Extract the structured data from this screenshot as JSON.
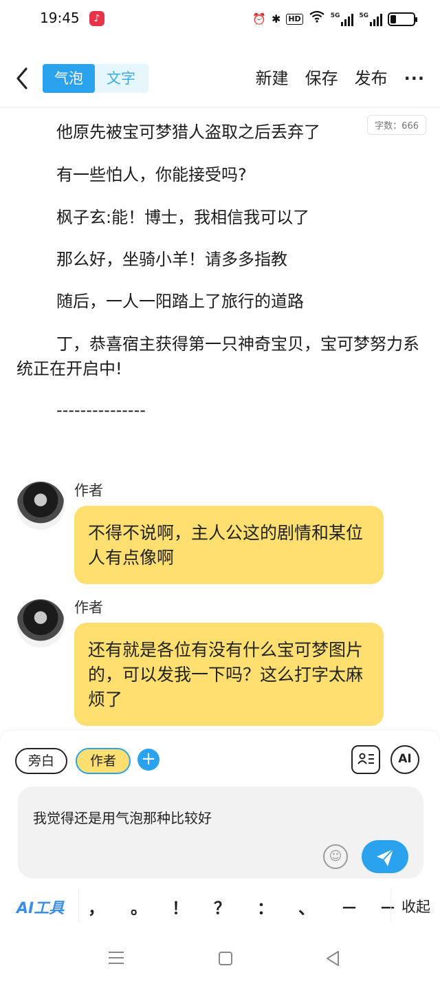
{
  "status_bar": {
    "time": "19:45",
    "battery_level": 0.25,
    "icons": [
      "alarm-icon",
      "bluetooth-icon",
      "hd-icon",
      "wifi-icon",
      "signal-5g-icon",
      "signal-5g-icon",
      "battery-icon"
    ],
    "hd_label": "HD",
    "net1_label": "5G",
    "net2_label": "5G"
  },
  "header": {
    "mode_tabs": [
      {
        "label": "气泡",
        "active": true
      },
      {
        "label": "文字",
        "active": false
      }
    ],
    "actions": {
      "new_label": "新建",
      "save_label": "保存",
      "publish_label": "发布",
      "more_label": "···"
    }
  },
  "word_count": "字数：666",
  "paragraphs": [
    "他原先被宝可梦猎人盗取之后丢弃了",
    "有一些怕人，你能接受吗?",
    "枫子玄:能！博士，我相信我可以了",
    "那么好，坐骑小羊！请多多指教",
    "随后，一人一阳踏上了旅行的道路",
    "丁，恭喜宿主获得第一只神奇宝贝，宝可梦努力系统正在开启中!",
    "---------------"
  ],
  "messages": [
    {
      "author": "作者",
      "text": "不得不说啊，主人公这的剧情和某位人有点像啊"
    },
    {
      "author": "作者",
      "text": "还有就是各位有没有什么宝可梦图片的，可以发我一下吗？这么打字太麻烦了"
    }
  ],
  "editor": {
    "roles": [
      {
        "label": "旁白",
        "selected": false
      },
      {
        "label": "作者",
        "selected": true
      }
    ],
    "add_role_label": "+",
    "ai_label": "AI",
    "input_text": "我觉得还是用气泡那种比较好",
    "emoji_label": "☺"
  },
  "toolbar": {
    "ai_tools_label": "AI工具",
    "punctuation": [
      "，",
      "。",
      "！",
      "？",
      "：",
      "、",
      "－",
      "－"
    ],
    "collapse_label": "收起"
  },
  "colors": {
    "accent": "#2ba2ee",
    "bubble": "#fedf6f",
    "accent_light": "#e6f6fd"
  }
}
